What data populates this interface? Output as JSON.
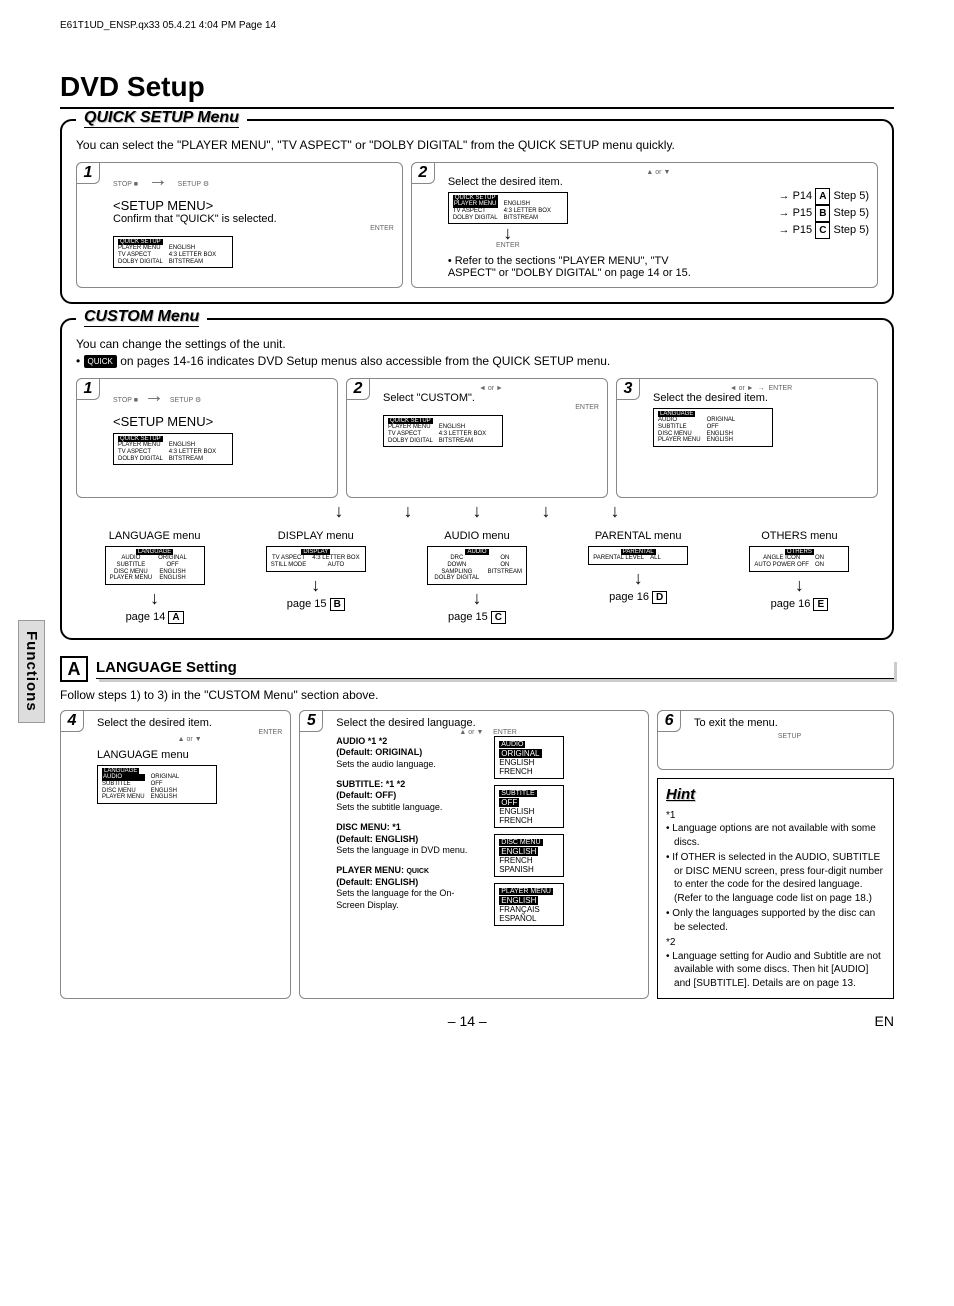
{
  "header_line": "E61T1UD_ENSP.qx33  05.4.21 4:04 PM  Page 14",
  "title": "DVD Setup",
  "side_tab": "Functions",
  "quick": {
    "title": "QUICK SETUP Menu",
    "intro": "You can select the \"PLAYER MENU\", \"TV ASPECT\" or \"DOLBY DIGITAL\" from the QUICK SETUP menu quickly.",
    "step1": {
      "num": "1",
      "label_stop": "STOP",
      "label_setup": "SETUP",
      "menu_label": "<SETUP MENU>",
      "confirm": "Confirm that \"QUICK\" is selected.",
      "enter": "ENTER",
      "screen_header": "QUICK SETUP",
      "rows_l": [
        "PLAYER MENU",
        "TV ASPECT",
        "DOLBY DIGITAL"
      ],
      "rows_r": [
        "ENGLISH",
        "4:3 LETTER BOX",
        "BITSTREAM"
      ]
    },
    "step2": {
      "num": "2",
      "or": "or",
      "select": "Select the desired item.",
      "screen_header": "QUICK SETUP",
      "rows_l": [
        "PLAYER MENU",
        "TV ASPECT",
        "DOLBY DIGITAL"
      ],
      "rows_r": [
        "ENGLISH",
        "4:3 LETTER BOX",
        "BITSTREAM"
      ],
      "enter": "ENTER",
      "refs": [
        {
          "page": "P14",
          "letter": "A",
          "step": "Step 5)"
        },
        {
          "page": "P15",
          "letter": "B",
          "step": "Step 5)"
        },
        {
          "page": "P15",
          "letter": "C",
          "step": "Step 5)"
        }
      ],
      "note": "• Refer to the sections \"PLAYER MENU\", \"TV ASPECT\" or \"DOLBY DIGITAL\" on page 14 or 15."
    }
  },
  "custom": {
    "title": "CUSTOM Menu",
    "intro1": "You can change the settings of the unit.",
    "intro2_pre": "• ",
    "intro2_badge": "QUICK",
    "intro2_post": " on pages 14-16 indicates DVD Setup menus also accessible from the QUICK SETUP menu.",
    "step1": {
      "num": "1",
      "label_stop": "STOP",
      "label_setup": "SETUP",
      "menu_label": "<SETUP MENU>",
      "screen_header": "QUICK SETUP",
      "rows_l": [
        "PLAYER MENU",
        "TV ASPECT",
        "DOLBY DIGITAL"
      ],
      "rows_r": [
        "ENGLISH",
        "4:3 LETTER BOX",
        "BITSTREAM"
      ]
    },
    "step2": {
      "num": "2",
      "or": "or",
      "select": "Select \"CUSTOM\".",
      "enter": "ENTER",
      "screen_header": "QUICK SETUP",
      "rows_l": [
        "PLAYER MENU",
        "TV ASPECT",
        "DOLBY DIGITAL"
      ],
      "rows_r": [
        "ENGLISH",
        "4:3 LETTER BOX",
        "BITSTREAM"
      ]
    },
    "step3": {
      "num": "3",
      "or": "or",
      "enter": "ENTER",
      "select": "Select the desired item.",
      "screen_header": "LANGUAGE",
      "rows_l": [
        "AUDIO",
        "SUBTITLE",
        "DISC MENU",
        "PLAYER MENU"
      ],
      "rows_r": [
        "ORIGINAL",
        "OFF",
        "ENGLISH",
        "ENGLISH"
      ]
    },
    "menus": [
      {
        "name": "LANGUAGE menu",
        "screen_header": "LANGUAGE",
        "rows_l": [
          "AUDIO",
          "SUBTITLE",
          "DISC MENU",
          "PLAYER MENU"
        ],
        "rows_r": [
          "ORIGINAL",
          "OFF",
          "ENGLISH",
          "ENGLISH"
        ],
        "page": "page 14",
        "letter": "A"
      },
      {
        "name": "DISPLAY menu",
        "screen_header": "DISPLAY",
        "rows_l": [
          "TV ASPECT",
          "STILL MODE"
        ],
        "rows_r": [
          "4:3 LETTER BOX",
          "AUTO"
        ],
        "page": "page 15",
        "letter": "B"
      },
      {
        "name": "AUDIO menu",
        "screen_header": "AUDIO",
        "rows_l": [
          "DRC",
          "DOWN SAMPLING",
          "DOLBY DIGITAL"
        ],
        "rows_r": [
          "ON",
          "ON",
          "BITSTREAM"
        ],
        "page": "page 15",
        "letter": "C"
      },
      {
        "name": "PARENTAL menu",
        "screen_header": "PARENTAL",
        "rows_l": [
          "PARENTAL LEVEL"
        ],
        "rows_r": [
          "ALL"
        ],
        "page": "page 16",
        "letter": "D"
      },
      {
        "name": "OTHERS menu",
        "screen_header": "OTHERS",
        "rows_l": [
          "ANGLE ICON",
          "AUTO POWER OFF"
        ],
        "rows_r": [
          "ON",
          "ON"
        ],
        "page": "page 16",
        "letter": "E"
      }
    ]
  },
  "lang_setting": {
    "letter": "A",
    "title": "LANGUAGE Setting",
    "follow": "Follow steps 1) to 3) in the \"CUSTOM Menu\" section above.",
    "step4": {
      "num": "4",
      "select": "Select the desired item.",
      "or": "or",
      "enter": "ENTER",
      "menu_label": "LANGUAGE menu",
      "screen_header": "LANGUAGE",
      "rows_l": [
        "AUDIO",
        "SUBTITLE",
        "DISC MENU",
        "PLAYER MENU"
      ],
      "rows_r": [
        "ORIGINAL",
        "OFF",
        "ENGLISH",
        "ENGLISH"
      ]
    },
    "step5": {
      "num": "5",
      "select": "Select the desired language.",
      "or": "or",
      "enter": "ENTER",
      "items": [
        {
          "head": "AUDIO *1 *2",
          "def": "(Default: ORIGINAL)",
          "desc": "Sets the audio language.",
          "opt_header": "AUDIO",
          "opts": [
            "ORIGINAL",
            "ENGLISH",
            "FRENCH"
          ]
        },
        {
          "head": "SUBTITLE: *1 *2",
          "def": "(Default: OFF)",
          "desc": "Sets the subtitle language.",
          "opt_header": "SUBTITLE",
          "opts": [
            "OFF",
            "ENGLISH",
            "FRENCH"
          ]
        },
        {
          "head": "DISC MENU: *1",
          "def": "(Default: ENGLISH)",
          "desc": "Sets the language in DVD menu.",
          "opt_header": "DISC MENU",
          "opts": [
            "ENGLISH",
            "FRENCH",
            "SPANISH"
          ]
        },
        {
          "head": "PLAYER MENU:",
          "badge": "QUICK",
          "def": "(Default: ENGLISH)",
          "desc": "Sets the language for the On-Screen Display.",
          "opt_header": "PLAYER MENU",
          "opts": [
            "ENGLISH",
            "FRANÇAIS",
            "ESPAÑOL"
          ]
        }
      ]
    },
    "step6": {
      "num": "6",
      "select": "To exit the menu.",
      "setup": "SETUP"
    }
  },
  "hint": {
    "title": "Hint",
    "n1": "*1",
    "n2": "*2",
    "lines1": [
      "Language options are not available with some discs.",
      "If OTHER is selected in the AUDIO, SUBTITLE or DISC MENU screen, press four-digit number to enter the code for the desired language. (Refer to the language code list on page 18.)",
      "Only the languages supported by the disc can be selected."
    ],
    "line2": "Language setting for Audio and Subtitle are not available with some discs. Then hit [AUDIO] and [SUBTITLE]. Details are on page 13."
  },
  "footer": {
    "page": "– 14 –",
    "lang": "EN"
  }
}
